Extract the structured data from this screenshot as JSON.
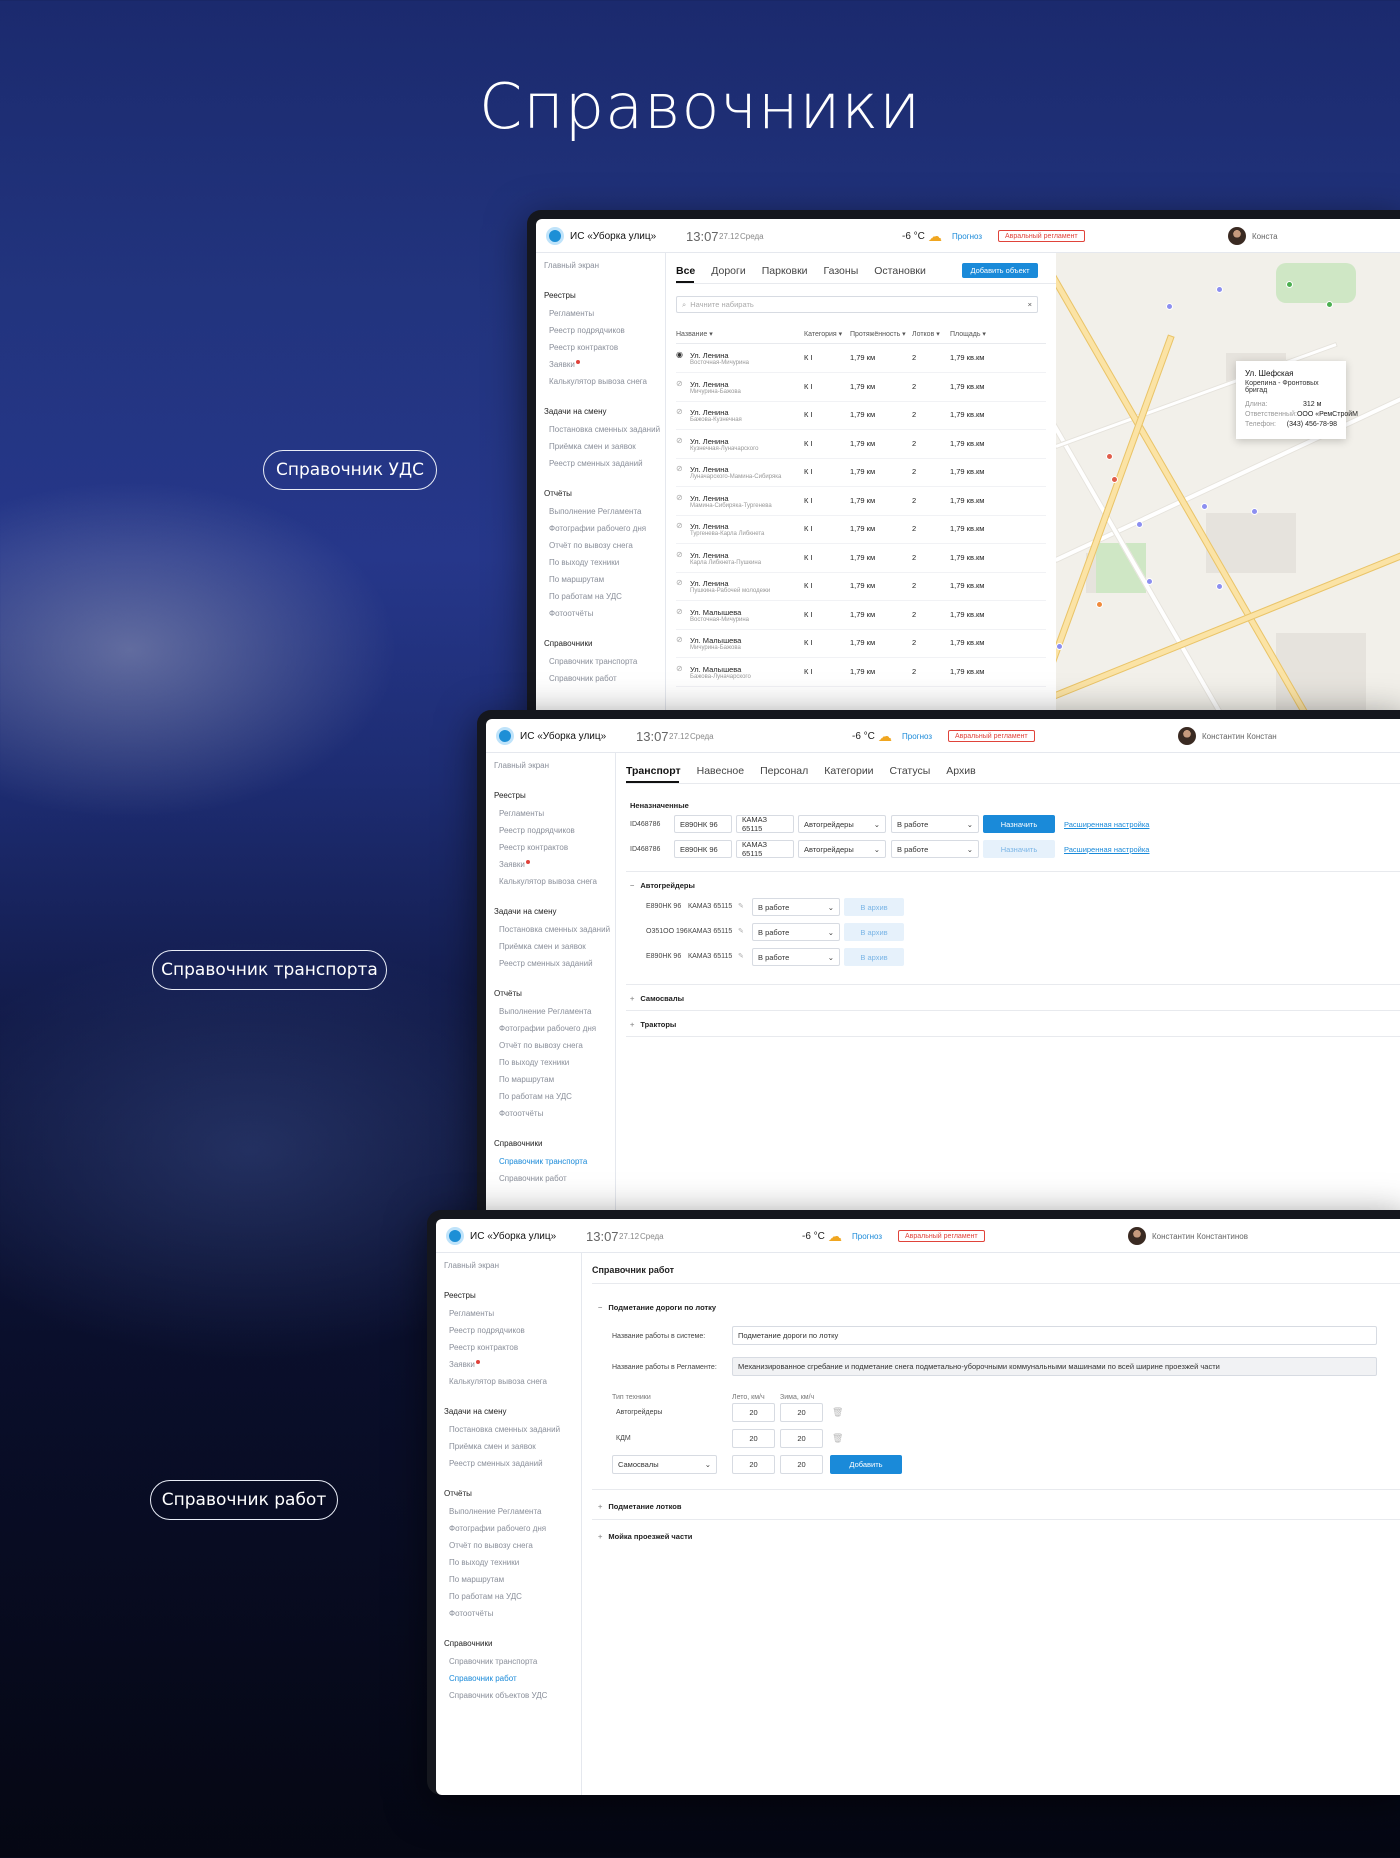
{
  "hero": {
    "title": "Справочники"
  },
  "labels": {
    "uds": "Справочник УДС",
    "transport": "Справочник транспорта",
    "works": "Справочник работ"
  },
  "header": {
    "app_title": "ИС «Уборка улиц»",
    "time": "13:07",
    "date": "27.12",
    "weekday": "Среда",
    "temperature": "-6 °C",
    "forecast": "Прогноз",
    "alarm": "Авральный регламент",
    "user_short": "Конста",
    "user_mid": "Константин Констан",
    "user_full": "Константин Константинов"
  },
  "sidebar": {
    "home": "Главный экран",
    "registries": "Реестры",
    "registry_items": [
      "Регламенты",
      "Реестр подрядчиков",
      "Реестр контрактов",
      "Заявки",
      "Калькулятор вывоза снега"
    ],
    "shift_tasks": "Задачи на смену",
    "shift_items": [
      "Постановка сменных заданий",
      "Приёмка смен и заявок",
      "Реестр сменных заданий"
    ],
    "reports": "Отчёты",
    "report_items": [
      "Выполнение Регламента",
      "Фотографии рабочего дня",
      "Отчёт по вывозу снега",
      "По выходу техники",
      "По маршрутам",
      "По работам на УДС",
      "Фотоотчёты"
    ],
    "directories": "Справочники",
    "directory_items": [
      "Справочник транспорта",
      "Справочник работ",
      "Справочник объектов УДС"
    ]
  },
  "uds": {
    "tabs": [
      "Все",
      "Дороги",
      "Парковки",
      "Газоны",
      "Остановки"
    ],
    "add_button": "Добавить объект",
    "search_placeholder": "Начните набирать",
    "search_clear": "×",
    "columns": [
      "Название",
      "Категория",
      "Протяжённость",
      "Лотков",
      "Площадь"
    ],
    "rows": [
      {
        "name": "Ул. Ленина",
        "sub": "Восточная-Мичурина",
        "cat": "К I",
        "len": "1,79 км",
        "trays": "2",
        "area": "1,79 кв.км"
      },
      {
        "name": "Ул. Ленина",
        "sub": "Мичурина-Бажова",
        "cat": "К I",
        "len": "1,79 км",
        "trays": "2",
        "area": "1,79 кв.км"
      },
      {
        "name": "Ул. Ленина",
        "sub": "Бажова-Кузнечная",
        "cat": "К I",
        "len": "1,79 км",
        "trays": "2",
        "area": "1,79 кв.км"
      },
      {
        "name": "Ул. Ленина",
        "sub": "Кузнечная-Луначарского",
        "cat": "К I",
        "len": "1,79 км",
        "trays": "2",
        "area": "1,79 кв.км"
      },
      {
        "name": "Ул. Ленина",
        "sub": "Луначарского-Мамина-Сибиряка",
        "cat": "К I",
        "len": "1,79 км",
        "trays": "2",
        "area": "1,79 кв.км"
      },
      {
        "name": "Ул. Ленина",
        "sub": "Мамина-Сибиряка-Тургенева",
        "cat": "К I",
        "len": "1,79 км",
        "trays": "2",
        "area": "1,79 кв.км"
      },
      {
        "name": "Ул. Ленина",
        "sub": "Тургенева-Карла Либкнета",
        "cat": "К I",
        "len": "1,79 км",
        "trays": "2",
        "area": "1,79 кв.км"
      },
      {
        "name": "Ул. Ленина",
        "sub": "Карла Либкнета-Пушкина",
        "cat": "К I",
        "len": "1,79 км",
        "trays": "2",
        "area": "1,79 кв.км"
      },
      {
        "name": "Ул. Ленина",
        "sub": "Пушкина-Рабочей молодежи",
        "cat": "К I",
        "len": "1,79 км",
        "trays": "2",
        "area": "1,79 кв.км"
      },
      {
        "name": "Ул. Малышева",
        "sub": "Восточная-Мичурина",
        "cat": "К I",
        "len": "1,79 км",
        "trays": "2",
        "area": "1,79 кв.км"
      },
      {
        "name": "Ул. Малышева",
        "sub": "Мичурина-Бажова",
        "cat": "К I",
        "len": "1,79 км",
        "trays": "2",
        "area": "1,79 кв.км"
      },
      {
        "name": "Ул. Малышева",
        "sub": "Бажова-Луначарского",
        "cat": "К I",
        "len": "1,79 км",
        "trays": "2",
        "area": "1,79 кв.км"
      }
    ],
    "popup": {
      "title": "Ул. Шефская",
      "sub": "Корепина - Фронтовых бригад",
      "len_label": "Длина:",
      "len_value": "312 м",
      "resp_label": "Ответственный:",
      "resp_value": "ООО «РемСтройМ",
      "phone_label": "Телефон:",
      "phone_value": "(343) 456-78-98"
    }
  },
  "transport": {
    "tabs": [
      "Транспорт",
      "Навесное",
      "Персонал",
      "Категории",
      "Статусы",
      "Архив"
    ],
    "unassigned_title": "Неназначенные",
    "unassigned": [
      {
        "id": "ID468786",
        "plate": "Е890НК 96",
        "model": "КАМАЗ 65115",
        "type": "Автогрейдеры",
        "status": "В работе",
        "assign": "Назначить",
        "link": "Расширенная настройка"
      },
      {
        "id": "ID468786",
        "plate": "Е890НК 96",
        "model": "КАМАЗ 65115",
        "type": "Автогрейдеры",
        "status": "В работе",
        "assign": "Назначить",
        "link": "Расширенная настройка"
      }
    ],
    "groups": [
      {
        "name": "Автогрейдеры",
        "sign": "−",
        "items": [
          {
            "plate": "Е890НК 96",
            "model": "КАМАЗ 65115",
            "status": "В работе",
            "archive": "В архив"
          },
          {
            "plate": "О351ОО 196",
            "model": "КАМАЗ 65115",
            "status": "В работе",
            "archive": "В архив"
          },
          {
            "plate": "Е890НК 96",
            "model": "КАМАЗ 65115",
            "status": "В работе",
            "archive": "В архив"
          }
        ]
      },
      {
        "name": "Самосвалы",
        "sign": "+"
      },
      {
        "name": "Тракторы",
        "sign": "+"
      }
    ]
  },
  "works": {
    "title": "Справочник работ",
    "section1": "Подметание дороги по лотку",
    "sys_label": "Название работы в системе:",
    "sys_value": "Подметание дороги по лотку",
    "reg_label": "Название работы в Регламенте:",
    "reg_value": "Механизированное сгребание и подметание снега подметально-уборочными коммунальными машинами по всей ширине проезжей части",
    "col_type": "Тип техники",
    "col_summer": "Лето, км/ч",
    "col_winter": "Зима, км/ч",
    "rows": [
      {
        "type": "Автогрейдеры",
        "summer": "20",
        "winter": "20"
      },
      {
        "type": "КДМ",
        "summer": "20",
        "winter": "20"
      }
    ],
    "new_type": "Самосвалы",
    "new_summer": "20",
    "new_winter": "20",
    "add": "Добавить",
    "section2": "Подметание лотков",
    "section3": "Мойка проезжей части"
  }
}
